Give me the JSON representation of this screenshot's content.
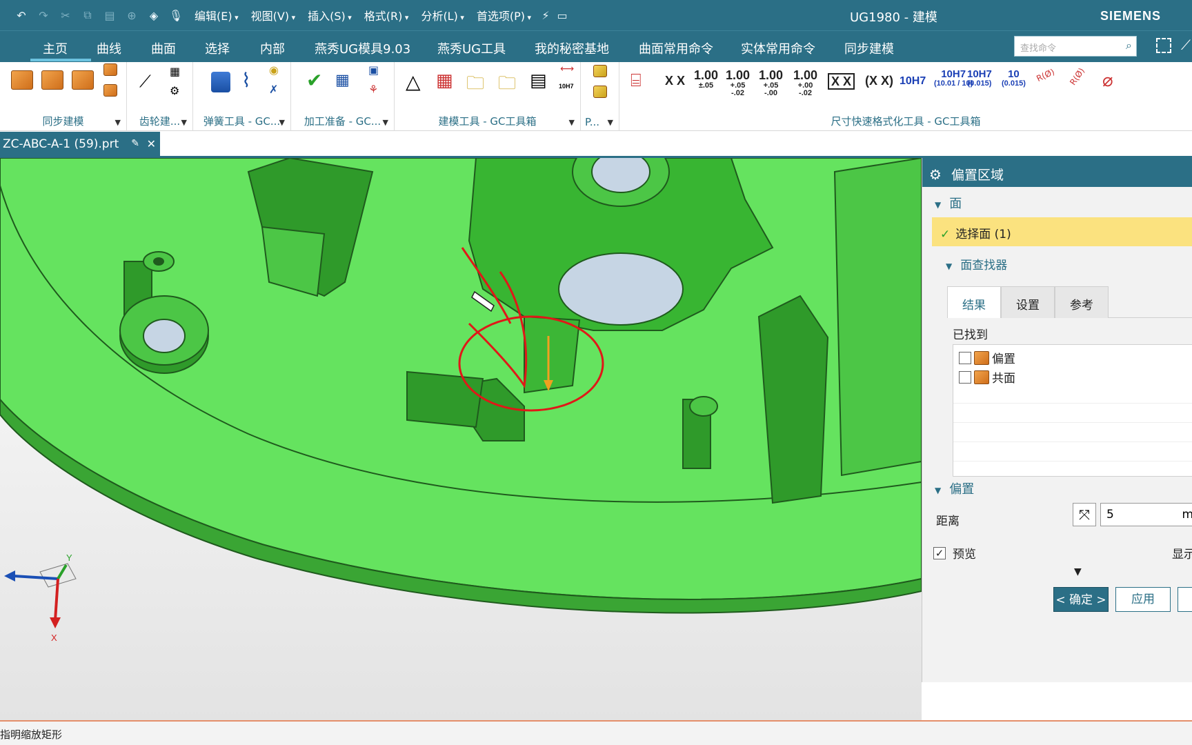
{
  "window": {
    "title": "UG1980 - 建模",
    "brand": "SIEMENS"
  },
  "menu": [
    "编辑(E)",
    "视图(V)",
    "插入(S)",
    "格式(R)",
    "分析(L)",
    "首选项(P)"
  ],
  "tabs": [
    "主页",
    "曲线",
    "曲面",
    "选择",
    "内部",
    "燕秀UG模具9.03",
    "燕秀UG工具",
    "我的秘密基地",
    "曲面常用命令",
    "实体常用命令",
    "同步建模"
  ],
  "command_search": {
    "placeholder": "查找命令"
  },
  "ribbon": {
    "groups": [
      "同步建模",
      "齿轮建...",
      "弹簧工具 - GC...",
      "加工准备 - GC...",
      "建模工具 - GC工具箱",
      "P...",
      "尺寸快速格式化工具 - GC工具箱"
    ],
    "dims": {
      "xx": "X X",
      "t1": {
        "main": "1.00",
        "tol": "±.05"
      },
      "t2": {
        "main": "1.00",
        "up": "+.05",
        "low": "-.02"
      },
      "t3": {
        "main": "1.00",
        "up": "+.05",
        "low": "-.00"
      },
      "t4": {
        "main": "1.00",
        "up": "+.00",
        "low": "-.02"
      },
      "boxx": "X X",
      "parenx": "(X X)",
      "h7": "10H7",
      "h7b": {
        "main": "10H7",
        "sub": "(10.01 / 10)"
      },
      "h7c": {
        "main": "10H7",
        "sub": "(0.015)"
      },
      "h7d": {
        "main": "10",
        "sub": "(0.015)"
      },
      "r1": "R(Ø)",
      "r2": "R(Ø)",
      "tenh7": "10H7"
    }
  },
  "document": {
    "tab": "ZC-ABC-A-1 (59).prt"
  },
  "triad": {
    "y": "Y",
    "x": "X"
  },
  "dialog": {
    "title": "偏置区域",
    "face_section": "面",
    "select_face": "选择面 (1)",
    "finder_section": "面查找器",
    "finder_tabs": [
      "结果",
      "设置",
      "参考"
    ],
    "found_label": "已找到",
    "found_items": [
      "偏置",
      "共面"
    ],
    "offset_section": "偏置",
    "distance_label": "距离",
    "distance_value": "5",
    "distance_unit": "m",
    "preview_label": "预览",
    "show_result": "显示",
    "ok": "< 确定 >",
    "apply": "应用"
  },
  "status": {
    "text": "指明缩放矩形"
  }
}
